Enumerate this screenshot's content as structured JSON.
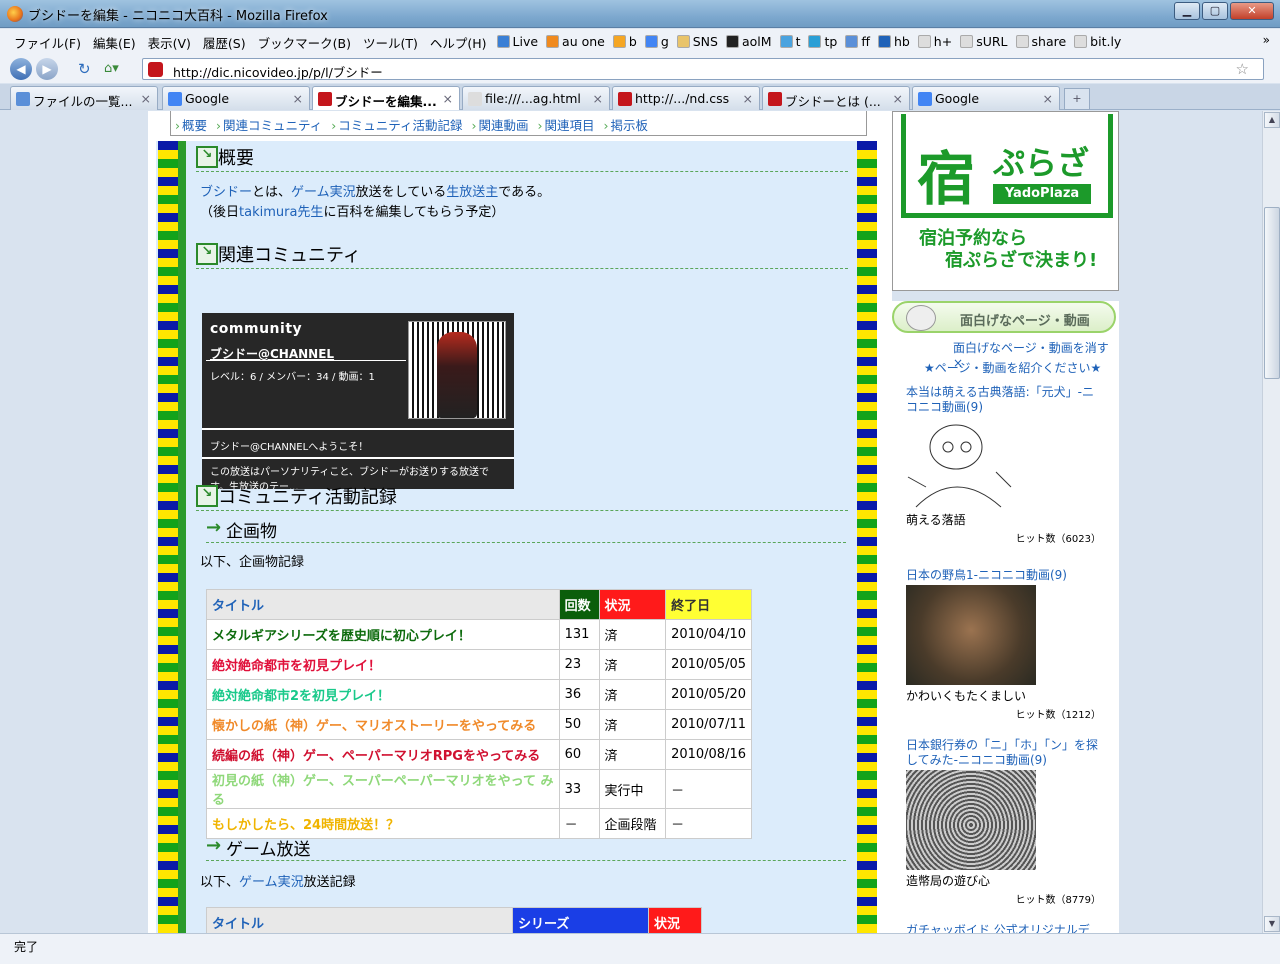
{
  "window": {
    "title": "ブシドーを編集 - ニコニコ大百科 - Mozilla Firefox"
  },
  "menu": [
    "ファイル(F)",
    "編集(E)",
    "表示(V)",
    "履歴(S)",
    "ブックマーク(B)",
    "ツール(T)",
    "ヘルプ(H)"
  ],
  "bookmarks": [
    {
      "label": "Live",
      "color": "#3a7fd5"
    },
    {
      "label": "au one",
      "color": "#f08a1e"
    },
    {
      "label": "b",
      "color": "#f5a623"
    },
    {
      "label": "g",
      "color": "#4285f4"
    },
    {
      "label": "SNS",
      "color": "#e9c46a"
    },
    {
      "label": "aolM",
      "color": "#222222"
    },
    {
      "label": "t",
      "color": "#4aa3df"
    },
    {
      "label": "tp",
      "color": "#2a9fd6"
    },
    {
      "label": "ff",
      "color": "#5a8fd8"
    },
    {
      "label": "hb",
      "color": "#1f62b8"
    },
    {
      "label": "h+",
      "color": "#dddddd"
    },
    {
      "label": "sURL",
      "color": "#dddddd"
    },
    {
      "label": "share",
      "color": "#dddddd"
    },
    {
      "label": "bit.ly",
      "color": "#dddddd"
    }
  ],
  "menu_more": "»",
  "nav": {
    "url": "http://dic.nicovideo.jp/p/l/ブシドー",
    "back": "◀",
    "forward": "▶"
  },
  "tabs": [
    {
      "label": "ファイルの一覧...",
      "color": "#5a8fd8"
    },
    {
      "label": "Google",
      "color": "#4285f4"
    },
    {
      "label": "ブシドーを編集...",
      "color": "#c4161c",
      "active": true
    },
    {
      "label": "file:///...ag.html",
      "color": "#dddddd"
    },
    {
      "label": "http://.../nd.css",
      "color": "#c4161c"
    },
    {
      "label": "ブシドーとは (...",
      "color": "#c4161c"
    },
    {
      "label": "Google",
      "color": "#4285f4"
    }
  ],
  "topnav": [
    "概要",
    "関連コミュニティ",
    "コミュニティ活動記録",
    "関連動画",
    "関連項目",
    "掲示板"
  ],
  "article": {
    "h_overview": "概要",
    "overview_line1": {
      "a": "ブシドー",
      "b": "とは、",
      "c": "ゲーム実況",
      "d": "放送をしている",
      "e": "生放送主",
      "f": "である。"
    },
    "overview_line2": {
      "a": "（後日",
      "b": "takimura先生",
      "c": "に百科を編集してもらう予定）"
    },
    "h_community": "関連コミュニティ",
    "community": {
      "header": "community",
      "name": "ブシドー@CHANNEL",
      "stats": "レベル：6 / メンバー：34 / 動画：1",
      "welcome": "ブシドー@CHANNELへようこそ！",
      "desc": "この放送はパーソナリティこと、ブシドーがお送りする放送です。生放送のテー..."
    },
    "h_activity": "コミュニティ活動記録",
    "h_kikaku": "企画物",
    "kikaku_intro": "以下、企画物記録",
    "kikaku_headers": {
      "title": "タイトル",
      "count": "回数",
      "status": "状況",
      "end": "終了日"
    },
    "kikaku_rows": [
      {
        "title": "メタルギアシリーズを歴史順に初心プレイ！",
        "color": "#0d6b0d",
        "count": "131",
        "status": "済",
        "end": "2010/04/10"
      },
      {
        "title": "絶対絶命都市を初見プレイ！",
        "color": "#e0103a",
        "count": "23",
        "status": "済",
        "end": "2010/05/05"
      },
      {
        "title": "絶対絶命都市2を初見プレイ！",
        "color": "#19c98a",
        "count": "36",
        "status": "済",
        "end": "2010/05/20"
      },
      {
        "title": "懐かしの紙（神）ゲー、マリオストーリーをやってみる",
        "color": "#f08a2a",
        "count": "50",
        "status": "済",
        "end": "2010/07/11"
      },
      {
        "title": "続編の紙（神）ゲー、ペーパーマリオRPGをやってみる",
        "color": "#d01030",
        "count": "60",
        "status": "済",
        "end": "2010/08/16"
      },
      {
        "title": "初見の紙（神）ゲー、スーパーペーパーマリオをやって みる",
        "color": "#8fd87a",
        "count": "33",
        "status": "実行中",
        "end": "－"
      },
      {
        "title": "もしかしたら、24時間放送！？",
        "color": "#f0b400",
        "count": "－",
        "status": "企画段階",
        "end": "－"
      }
    ],
    "h_game": "ゲーム放送",
    "game_intro": {
      "a": "以下、",
      "b": "ゲーム実況",
      "c": "放送記録"
    },
    "game_headers": {
      "title": "タイトル",
      "series": "シリーズ",
      "status": "状況"
    }
  },
  "sidebar": {
    "ad": {
      "yado": "宿",
      "pura": "ぷらざ",
      "yp": "YadoPlaza",
      "line1": "宿泊予約なら",
      "line2": "宿ぷらざで決まり!"
    },
    "panel_title": "面白げなページ・動画",
    "hide_link": "面白げなページ・動画を消す ×",
    "intro_link": "★ページ・動画を紹介ください★",
    "items": [
      {
        "title": "本当は萌える古典落語:「元犬」-ニコニコ動画(9)",
        "caption": "萌える落語",
        "hits": "ヒット数（6023）"
      },
      {
        "title": "日本の野鳥1-ニコニコ動画(9)",
        "caption": "かわいくもたくましい",
        "hits": "ヒット数（1212）"
      },
      {
        "title": "日本銀行券の「ニ」「ホ」「ン」を探してみた-ニコニコ動画(9)",
        "caption": "造幣局の遊び心",
        "hits": "ヒット数（8779）"
      },
      {
        "title": "ガチャッボイド 公式オリジナルデモ",
        "caption": "",
        "hits": ""
      }
    ]
  },
  "status": "完了"
}
